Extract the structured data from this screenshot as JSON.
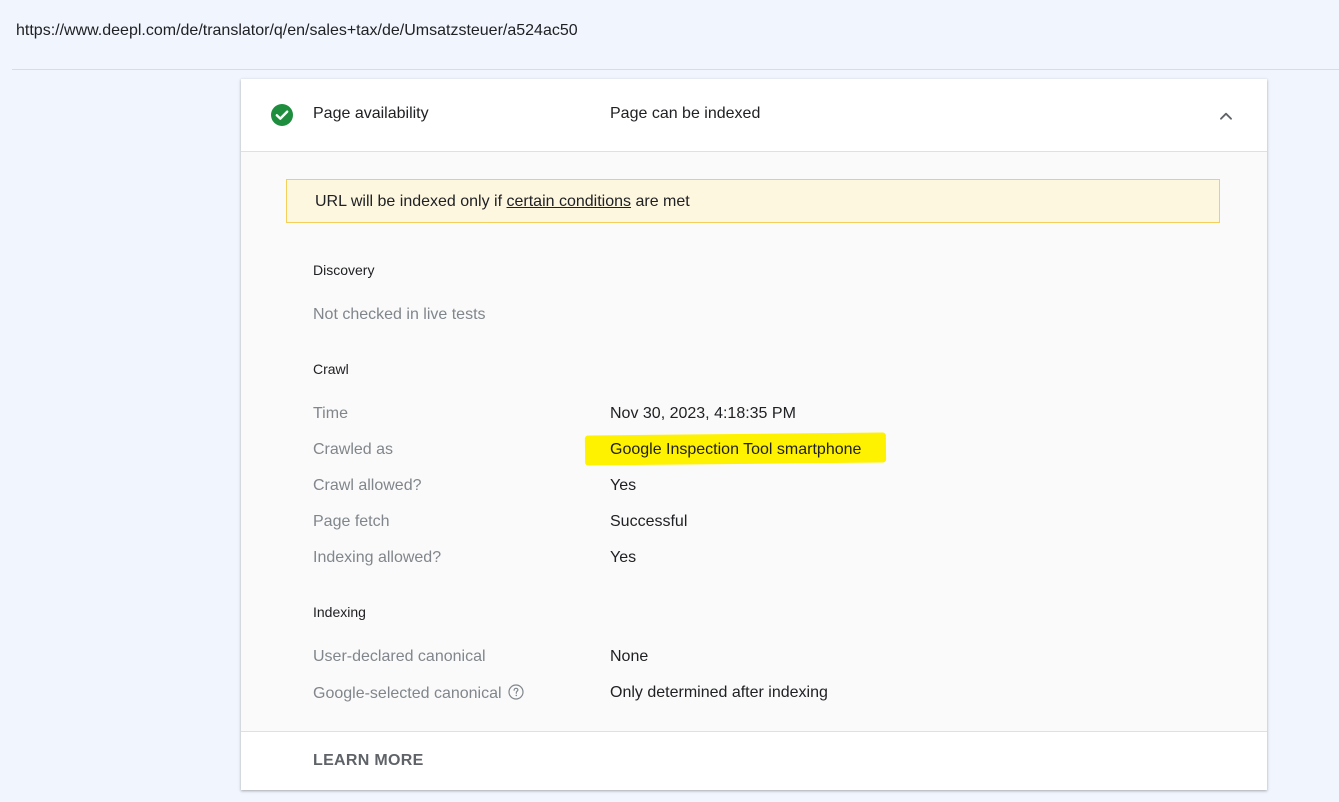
{
  "url": "https://www.deepl.com/de/translator/q/en/sales+tax/de/Umsatzsteuer/a524ac50",
  "header": {
    "label": "Page availability",
    "status": "Page can be indexed",
    "status_icon": "check-circle-icon",
    "status_color": "#1e8e3e",
    "toggle_icon": "chevron-up-icon"
  },
  "notice": {
    "before": "URL will be indexed only if ",
    "link": "certain conditions",
    "after": " are met"
  },
  "discovery": {
    "title": "Discovery",
    "text": "Not checked in live tests"
  },
  "crawl": {
    "title": "Crawl",
    "rows": [
      {
        "label": "Time",
        "value": "Nov 30, 2023, 4:18:35 PM"
      },
      {
        "label": "Crawled as",
        "value": "Google Inspection Tool smartphone"
      },
      {
        "label": "Crawl allowed?",
        "value": "Yes"
      },
      {
        "label": "Page fetch",
        "value": "Successful"
      },
      {
        "label": "Indexing allowed?",
        "value": "Yes"
      }
    ]
  },
  "indexing": {
    "title": "Indexing",
    "rows": [
      {
        "label": "User-declared canonical",
        "value": "None"
      },
      {
        "label": "Google-selected canonical",
        "value": "Only determined after indexing"
      }
    ]
  },
  "footer": {
    "learn_more": "LEARN MORE"
  },
  "colors": {
    "highlight": "#fff200",
    "notice_bg": "#fef7e0"
  }
}
